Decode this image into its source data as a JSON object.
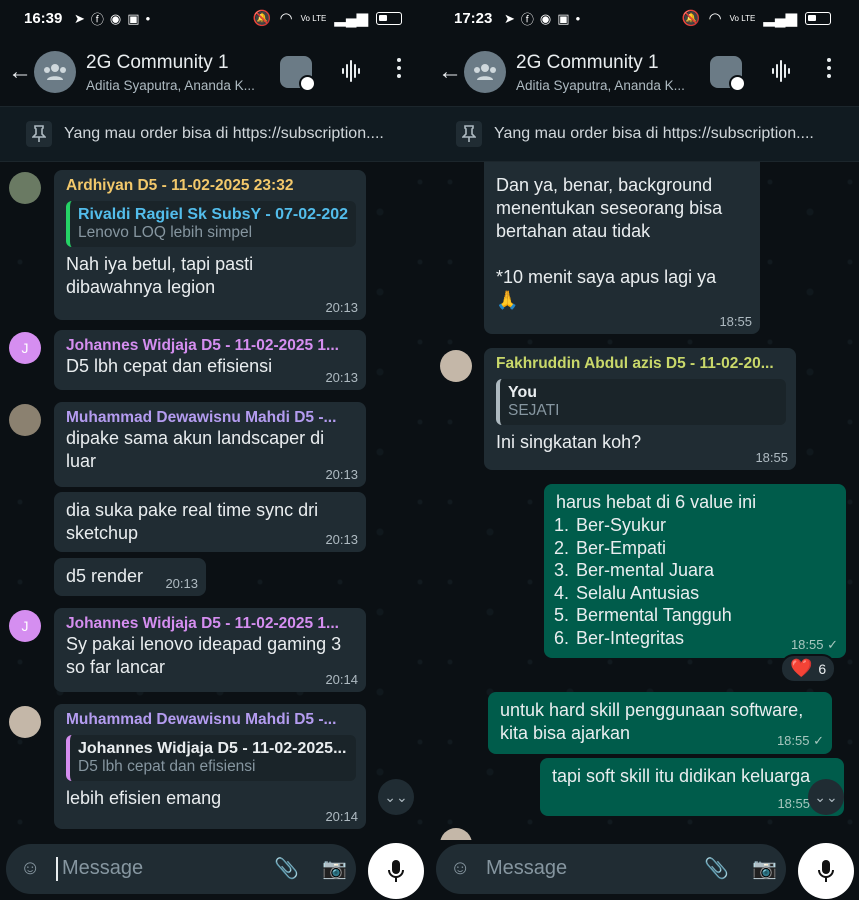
{
  "left": {
    "status": {
      "time": "16:39",
      "wifi_label": "Vo LTE"
    },
    "header": {
      "title": "2G Community 1",
      "subtitle": "Aditia Syaputra, Ananda K..."
    },
    "pinned": {
      "text": "Yang mau order bisa di https://subscription...."
    },
    "messages": [
      {
        "sender": "Ardhiyan D5 - 11-02-2025 23:32",
        "sender_color": "#f2c86b",
        "quote_name": "Rivaldi Ragiel Sk SubsY - 07-02-202...",
        "quote_text": "Lenovo LOQ lebih simpel",
        "quote_color": "#53bdeb",
        "text": "Nah iya betul, tapi pasti\ndibawahnya legion",
        "time": "20:13"
      },
      {
        "sender": "Johannes Widjaja D5 - 11-02-2025 1...",
        "sender_color": "#d58ef0",
        "avatar_letter": "J",
        "text": "D5 lbh cepat dan efisiensi",
        "time": "20:13"
      },
      {
        "sender": "Muhammad Dewawisnu Mahdi D5 -...",
        "sender_color": "#b49cf0",
        "text": "dipake sama akun landscaper di\nluar",
        "time": "20:13"
      },
      {
        "text": "dia suka pake real time sync dri\nsketchup",
        "time": "20:13"
      },
      {
        "text": "d5 render",
        "time": "20:13"
      },
      {
        "sender": "Johannes Widjaja D5 - 11-02-2025 1...",
        "sender_color": "#d58ef0",
        "avatar_letter": "J",
        "text": "Sy pakai lenovo ideapad gaming 3\nso far lancar",
        "time": "20:14"
      },
      {
        "sender": "Muhammad Dewawisnu Mahdi D5 -...",
        "sender_color": "#b49cf0",
        "quote_name": "Johannes Widjaja D5 - 11-02-2025...",
        "quote_text": "D5 lbh cepat dan efisiensi",
        "quote_color": "#d58ef0",
        "text": "lebih efisien emang",
        "time": "20:14"
      }
    ],
    "input": {
      "placeholder": "Message"
    }
  },
  "right": {
    "status": {
      "time": "17:23",
      "wifi_label": "Vo LTE"
    },
    "header": {
      "title": "2G Community 1",
      "subtitle": "Aditia Syaputra, Ananda K..."
    },
    "pinned": {
      "text": "Yang mau order bisa di https://subscription...."
    },
    "messages": [
      {
        "text": "Dan ya, benar, background\nmenentukan seseorang bisa\nbertahan atau tidak\n\n*10 menit saya apus lagi ya\n🙏",
        "time": "18:55"
      },
      {
        "sender": "Fakhruddin Abdul azis D5 - 11-02-20...",
        "sender_color": "#c9d86a",
        "quote_name": "You",
        "quote_text": "SEJATI",
        "quote_color": "#e9edef",
        "text": "Ini singkatan koh?",
        "time": "18:55"
      },
      {
        "intro": "harus hebat di 6 value ini",
        "items": [
          "Ber-Syukur",
          "Ber-Empati",
          "Ber-mental Juara",
          "Selalu Antusias",
          "Bermental Tangguh",
          "Ber-Integritas"
        ],
        "time": "18:55 ✓",
        "reaction": {
          "emoji": "❤️",
          "count": "6"
        }
      },
      {
        "text": "untuk hard skill penggunaan software,\nkita bisa ajarkan",
        "time": "18:55 ✓"
      },
      {
        "text": "tapi soft skill itu didikan keluarga",
        "time": "18:55"
      }
    ],
    "input": {
      "placeholder": "Message"
    }
  },
  "colors": {
    "background": "#0b1014",
    "incoming": "#202c33",
    "outgoing": "#005c4b",
    "mic_button": "#ffffff"
  }
}
